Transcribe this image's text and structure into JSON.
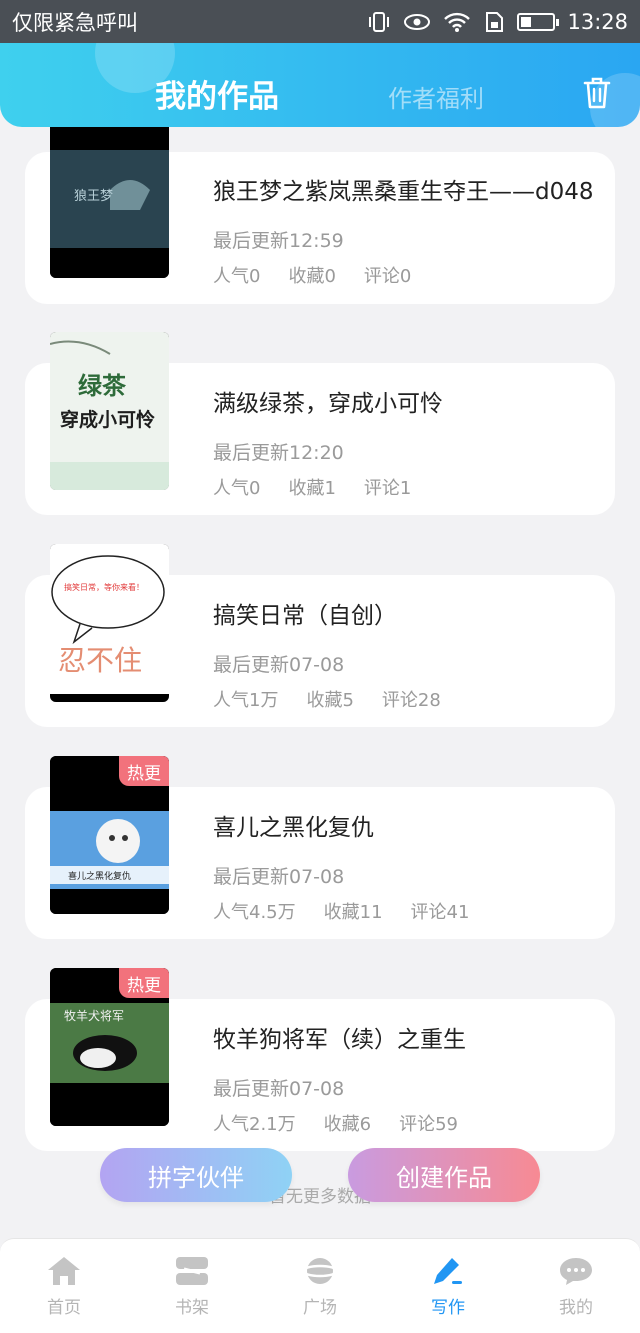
{
  "status_bar": {
    "carrier": "仅限紧急呼叫",
    "time": "13:28",
    "icons": [
      "vibrate-icon",
      "eye-icon",
      "wifi-icon",
      "sim-icon",
      "battery-icon"
    ]
  },
  "header": {
    "tab_mine": "我的作品",
    "tab_welfare": "作者福利",
    "delete_icon": "trash-icon"
  },
  "works": [
    {
      "title": "狼王梦之紫岚黑桑重生夺王——d048",
      "updated": "最后更新12:59",
      "popularity": "人气0",
      "favorites": "收藏0",
      "comments": "评论0",
      "hot": "",
      "cover_text": "狼王梦"
    },
    {
      "title": "满级绿茶，穿成小可怜",
      "updated": "最后更新12:20",
      "popularity": "人气0",
      "favorites": "收藏1",
      "comments": "评论1",
      "hot": "",
      "cover_text": "绿茶 穿成小可怜"
    },
    {
      "title": "搞笑日常（自创）",
      "updated": "最后更新07-08",
      "popularity": "人气1万",
      "favorites": "收藏5",
      "comments": "评论28",
      "hot": "",
      "cover_text": "搞笑日常，等你来看！"
    },
    {
      "title": "喜儿之黑化复仇",
      "updated": "最后更新07-08",
      "popularity": "人气4.5万",
      "favorites": "收藏11",
      "comments": "评论41",
      "hot": "热更",
      "cover_text": "喜儿之黑化复仇"
    },
    {
      "title": "牧羊狗将军（续）之重生",
      "updated": "最后更新07-08",
      "popularity": "人气2.1万",
      "favorites": "收藏6",
      "comments": "评论59",
      "hot": "热更",
      "cover_text": "牧羊犬将军"
    }
  ],
  "no_more": "暂无更多数据",
  "buttons": {
    "partner": "拼字伙伴",
    "create": "创建作品"
  },
  "nav": [
    {
      "label": "首页",
      "icon": "home-icon"
    },
    {
      "label": "书架",
      "icon": "bookshelf-icon"
    },
    {
      "label": "广场",
      "icon": "planet-icon"
    },
    {
      "label": "写作",
      "icon": "pen-icon"
    },
    {
      "label": "我的",
      "icon": "chat-icon"
    }
  ],
  "colors": {
    "accent": "#2196f3",
    "header_start": "#3fd0ee",
    "header_end": "#2aa6f2",
    "hot_badge": "#f2727c"
  }
}
